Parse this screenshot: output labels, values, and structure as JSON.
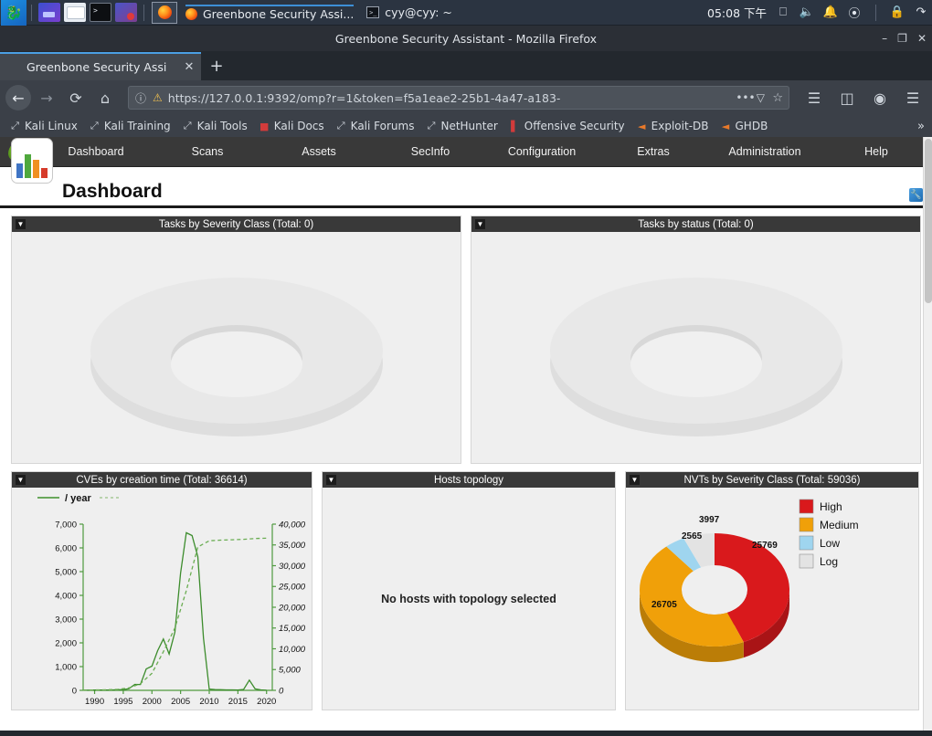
{
  "taskbar": {
    "menu_icon": "kali-dragon-icon",
    "launchers": [
      {
        "name": "files-launcher",
        "icon": "files-icon"
      },
      {
        "name": "folder-launcher",
        "icon": "folder-icon"
      },
      {
        "name": "terminal-launcher",
        "icon": "terminal-icon"
      },
      {
        "name": "recorder-launcher",
        "icon": "screen-record-icon"
      }
    ],
    "firefox_launcher": "firefox-icon",
    "windows": [
      {
        "title": "Greenbone Security Assi...",
        "icon": "firefox-icon",
        "active": true
      },
      {
        "title": "cyy@cyy: ~",
        "icon": "terminal-icon",
        "active": false
      }
    ],
    "clock": "05:08 下午",
    "tray": [
      "display-icon",
      "volume-icon",
      "bell-icon",
      "updates-icon",
      "lock-icon",
      "power-icon"
    ]
  },
  "browser": {
    "window_title": "Greenbone Security Assistant - Mozilla Firefox",
    "window_buttons": {
      "minimize": "–",
      "maximize": "❐",
      "close": "✕"
    },
    "tab": {
      "title": "Greenbone Security Assi",
      "close_label": "✕",
      "favicon": "greenbone-leaf-icon"
    },
    "new_tab_label": "+",
    "nav": {
      "back": "←",
      "forward": "→",
      "reload": "⟳",
      "home": "⌂",
      "url": "https://127.0.0.1:9392/omp?r=1&token=f5a1eae2-25b1-4a47-a183-",
      "page_actions": "•••",
      "pocket": "▽",
      "bookmark_star": "☆",
      "library": "library-icon",
      "sidebar": "sidebar-icon",
      "account": "account-icon",
      "menu": "☰"
    },
    "bookmarks": [
      {
        "label": "Kali Linux",
        "icon": "kali-dragon-icon"
      },
      {
        "label": "Kali Training",
        "icon": "kali-dragon-icon"
      },
      {
        "label": "Kali Tools",
        "icon": "kali-dragon-icon"
      },
      {
        "label": "Kali Docs",
        "icon": "kali-docs-icon"
      },
      {
        "label": "Kali Forums",
        "icon": "kali-dragon-icon"
      },
      {
        "label": "NetHunter",
        "icon": "kali-dragon-icon"
      },
      {
        "label": "Offensive Security",
        "icon": "offsec-icon"
      },
      {
        "label": "Exploit-DB",
        "icon": "exploit-db-icon"
      },
      {
        "label": "GHDB",
        "icon": "ghdb-icon"
      }
    ],
    "bookmarks_overflow": "»"
  },
  "gsa": {
    "logo": "greenbone-dragon-logo",
    "menu": [
      {
        "label": "Dashboard"
      },
      {
        "label": "Scans"
      },
      {
        "label": "Assets"
      },
      {
        "label": "SecInfo"
      },
      {
        "label": "Configuration"
      },
      {
        "label": "Extras"
      },
      {
        "label": "Administration"
      },
      {
        "label": "Help"
      }
    ],
    "page_title": "Dashboard",
    "page_icon": "dashboard-bars-icon",
    "edit_icon": "wrench-edit-icon",
    "caret_glyph": "▼",
    "panels": {
      "tasks_severity": {
        "title": "Tasks by Severity Class (Total: 0)"
      },
      "tasks_status": {
        "title": "Tasks by status (Total: 0)"
      },
      "cves": {
        "title": "CVEs by creation time (Total: 36614)"
      },
      "hosts": {
        "title": "Hosts topology",
        "empty_message": "No hosts with topology selected"
      },
      "nvts": {
        "title": "NVTs by Severity Class (Total: 59036)"
      }
    }
  },
  "chart_data": [
    {
      "id": "tasks-by-severity",
      "type": "pie",
      "title": "Tasks by Severity Class (Total: 0)",
      "labels": [],
      "values": [],
      "total": 0,
      "empty": true,
      "empty_color": "#e3e3e3"
    },
    {
      "id": "tasks-by-status",
      "type": "pie",
      "title": "Tasks by status (Total: 0)",
      "labels": [],
      "values": [],
      "total": 0,
      "empty": true,
      "empty_color": "#e3e3e3"
    },
    {
      "id": "cves-by-creation-time",
      "type": "line",
      "title": "CVEs by creation time (Total: 36614)",
      "xlabel": "",
      "ylabel": "",
      "legend": [
        {
          "label": "/ year",
          "style": "solid",
          "color": "#4f9a3f"
        },
        {
          "label": "",
          "style": "dashed",
          "color": "#7db56a"
        }
      ],
      "legend_position": "top-left",
      "grid": false,
      "x_ticks": [
        1990,
        1995,
        2000,
        2005,
        2010,
        2015,
        2020
      ],
      "xlim": [
        1988,
        2021
      ],
      "y_left_ticks": [
        0,
        1000,
        2000,
        3000,
        4000,
        5000,
        6000,
        7000
      ],
      "y_left_tick_labels": [
        "0",
        "1,000",
        "2,000",
        "3,000",
        "4,000",
        "5,000",
        "6,000",
        "7,000"
      ],
      "ylim_left": [
        0,
        7000
      ],
      "y_right_ticks": [
        0,
        5000,
        10000,
        15000,
        20000,
        25000,
        30000,
        35000,
        40000
      ],
      "y_right_tick_labels": [
        "0",
        "5,000",
        "10,000",
        "15,000",
        "20,000",
        "25,000",
        "30,000",
        "35,000",
        "40,000"
      ],
      "ylim_right": [
        0,
        40000
      ],
      "series": [
        {
          "name": "/ year",
          "style": "solid",
          "axis": "left",
          "x": [
            1988,
            1989,
            1990,
            1991,
            1992,
            1993,
            1994,
            1995,
            1996,
            1997,
            1998,
            1999,
            2000,
            2001,
            2002,
            2003,
            2004,
            2005,
            2006,
            2007,
            2008,
            2009,
            2010,
            2011,
            2012,
            2013,
            2014,
            2015,
            2016,
            2017,
            2018,
            2019,
            2020
          ],
          "values": [
            2,
            3,
            10,
            15,
            12,
            13,
            25,
            25,
            75,
            250,
            245,
            900,
            1020,
            1670,
            2160,
            1530,
            2450,
            4930,
            6640,
            6520,
            5630,
            2200,
            50,
            30,
            25,
            20,
            20,
            15,
            40,
            430,
            60,
            20,
            5
          ]
        },
        {
          "name": "cumulative",
          "style": "dashed",
          "axis": "right",
          "x": [
            1988,
            1990,
            1992,
            1994,
            1996,
            1998,
            2000,
            2002,
            2004,
            2006,
            2008,
            2010,
            2012,
            2014,
            2016,
            2018,
            2020
          ],
          "values": [
            40,
            90,
            140,
            210,
            600,
            1600,
            4100,
            9300,
            15000,
            24000,
            34500,
            36000,
            36150,
            36250,
            36350,
            36550,
            36614
          ]
        }
      ]
    },
    {
      "id": "nvts-by-severity-class",
      "type": "pie",
      "title": "NVTs by Severity Class (Total: 59036)",
      "donut": true,
      "total": 59036,
      "legend_position": "top-right",
      "labels": [
        "High",
        "Medium",
        "Low",
        "Log"
      ],
      "values": [
        25769,
        26705,
        2565,
        3997
      ],
      "value_labels": [
        "25769",
        "26705",
        "2565",
        "3997"
      ],
      "colors": [
        "#d9191c",
        "#f0a009",
        "#9fd5ef",
        "#e3e3e3"
      ]
    }
  ]
}
